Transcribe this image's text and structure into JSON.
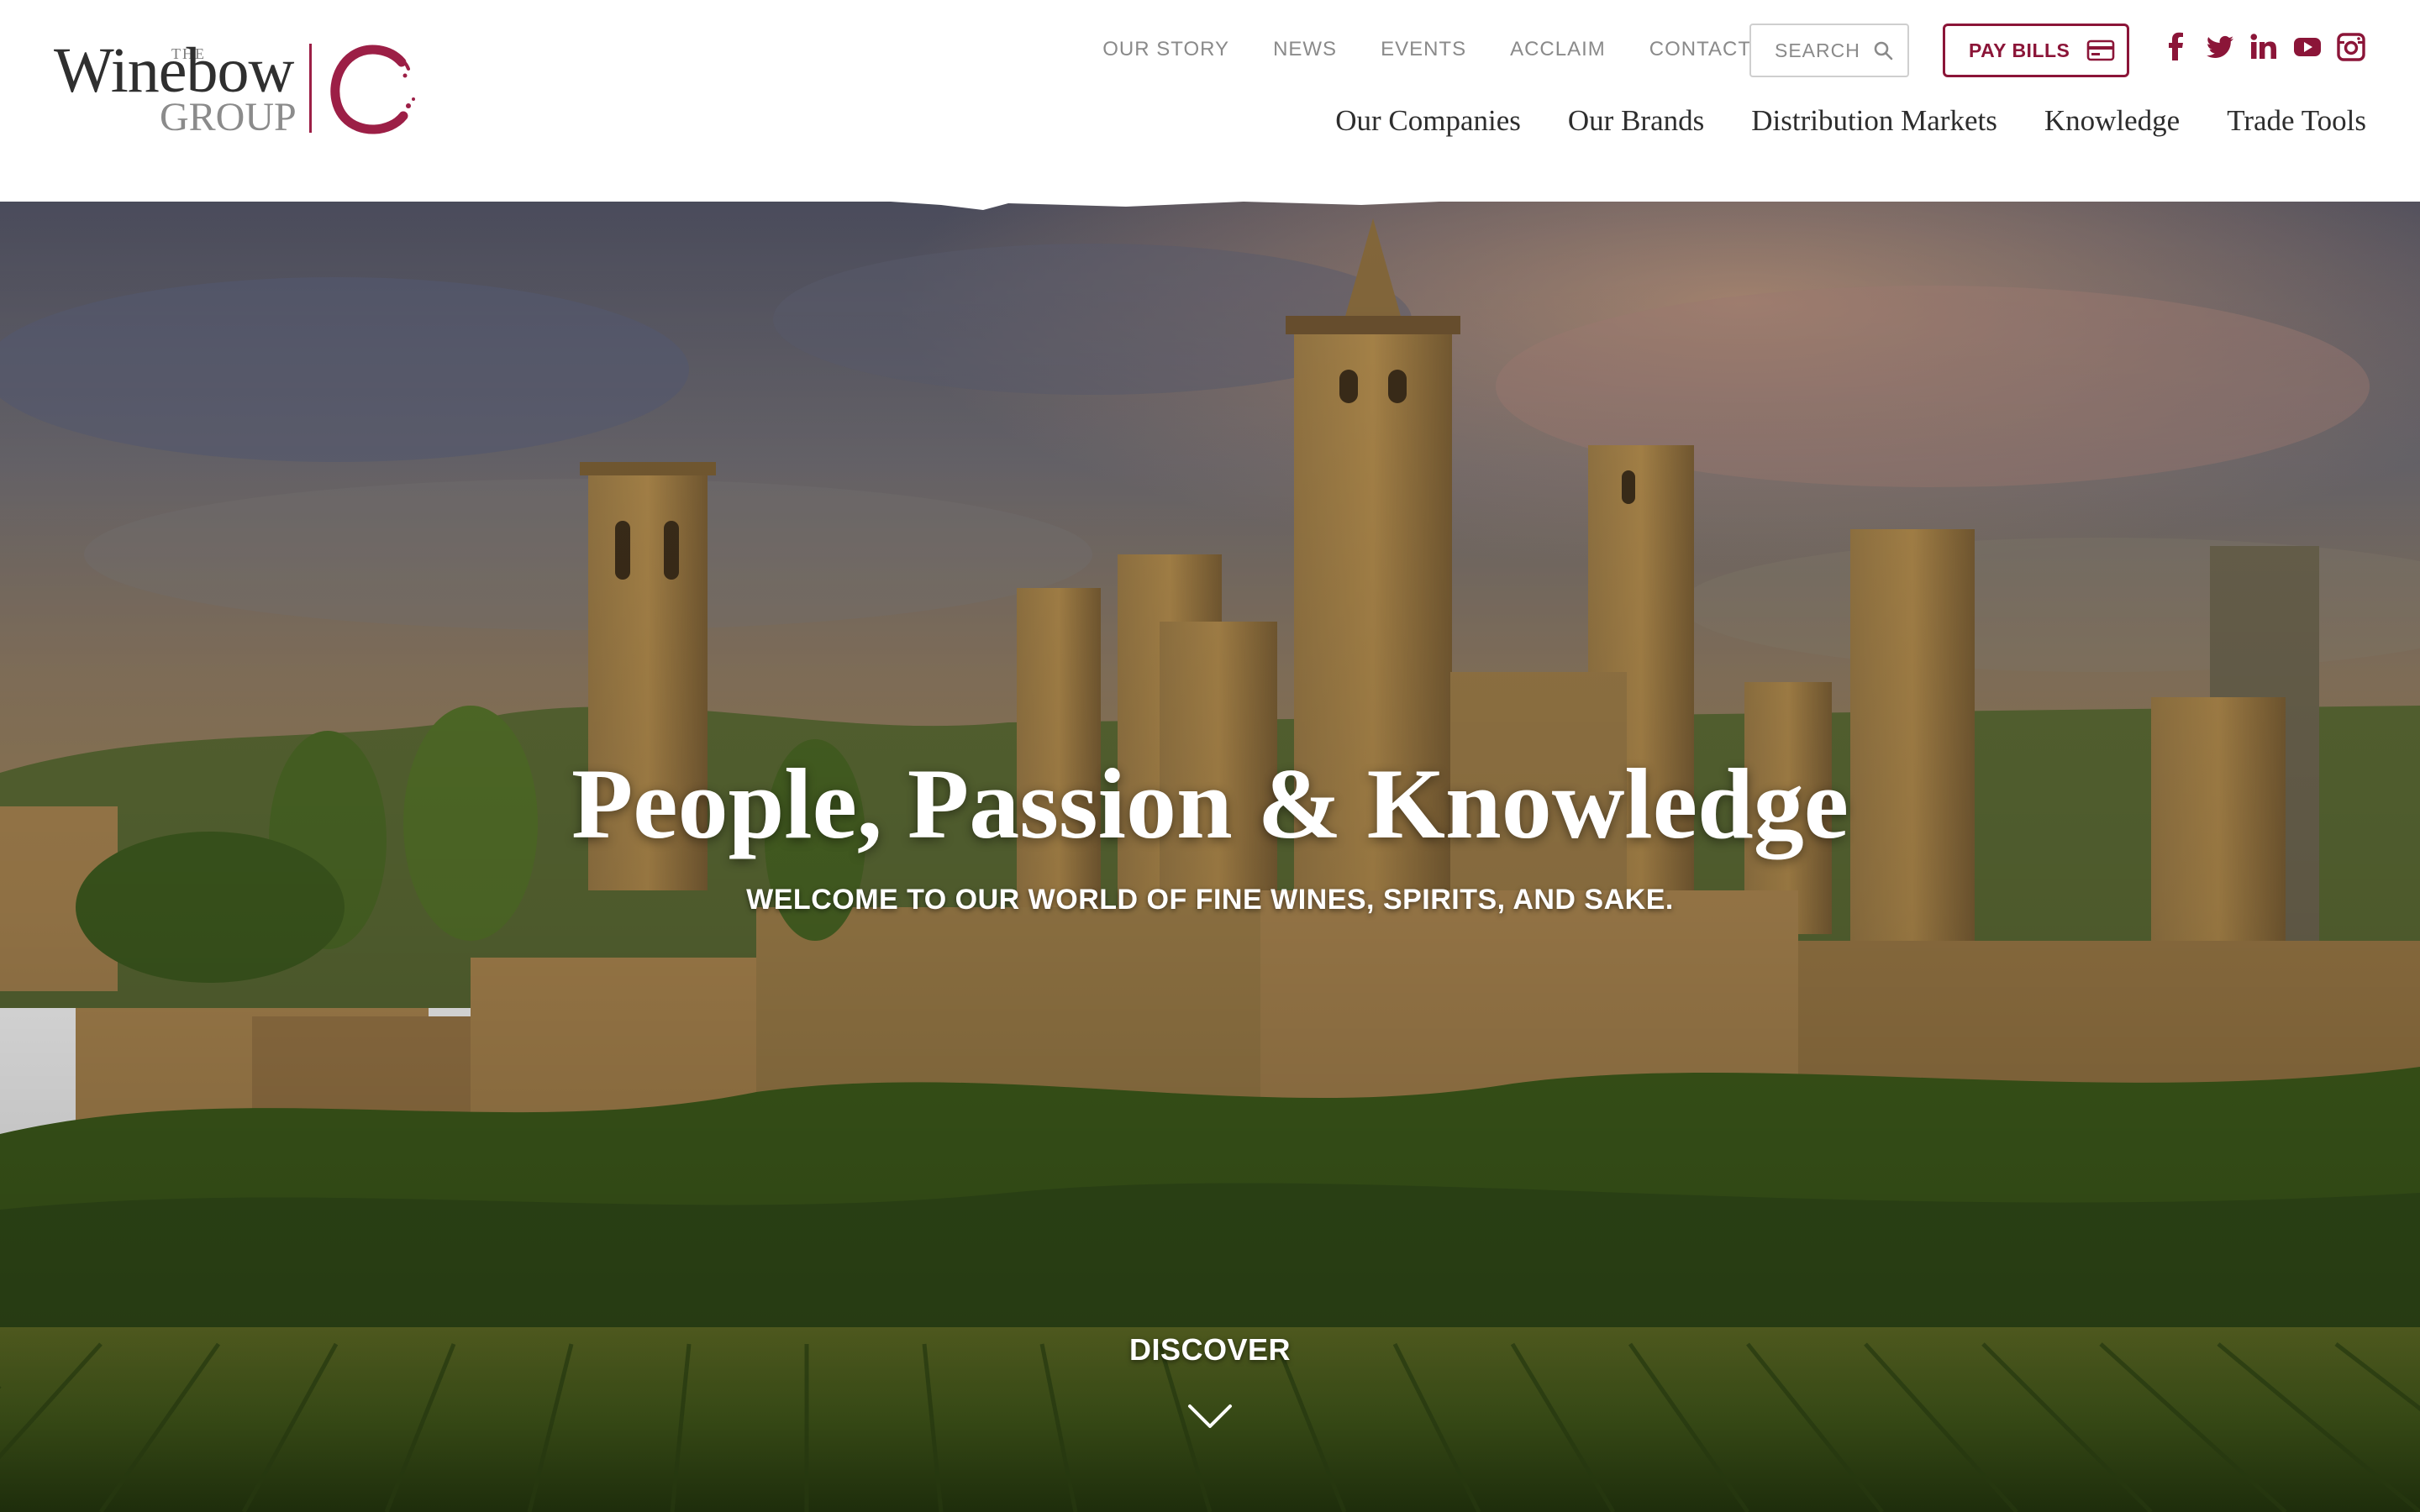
{
  "brand": {
    "logo_the": "THE",
    "logo_name": "Winebow",
    "logo_group": "GROUP",
    "accent_color": "#8b1538"
  },
  "utility_nav": {
    "items": [
      "OUR STORY",
      "NEWS",
      "EVENTS",
      "ACCLAIM",
      "CONTACT"
    ]
  },
  "search": {
    "placeholder": "SEARCH",
    "icon": "search-icon"
  },
  "pay_bills": {
    "label": "PAY BILLS",
    "icon": "credit-card-icon"
  },
  "social": {
    "icons": [
      "facebook-icon",
      "twitter-icon",
      "linkedin-icon",
      "youtube-icon",
      "instagram-icon"
    ]
  },
  "main_nav": {
    "items": [
      "Our Companies",
      "Our Brands",
      "Distribution Markets",
      "Knowledge",
      "Trade Tools"
    ]
  },
  "hero": {
    "title": "People, Passion & Knowledge",
    "subtitle": "WELCOME TO OUR WORLD OF FINE WINES, SPIRITS, AND SAKE.",
    "cta": "DISCOVER",
    "cta_icon": "chevron-down-icon"
  }
}
